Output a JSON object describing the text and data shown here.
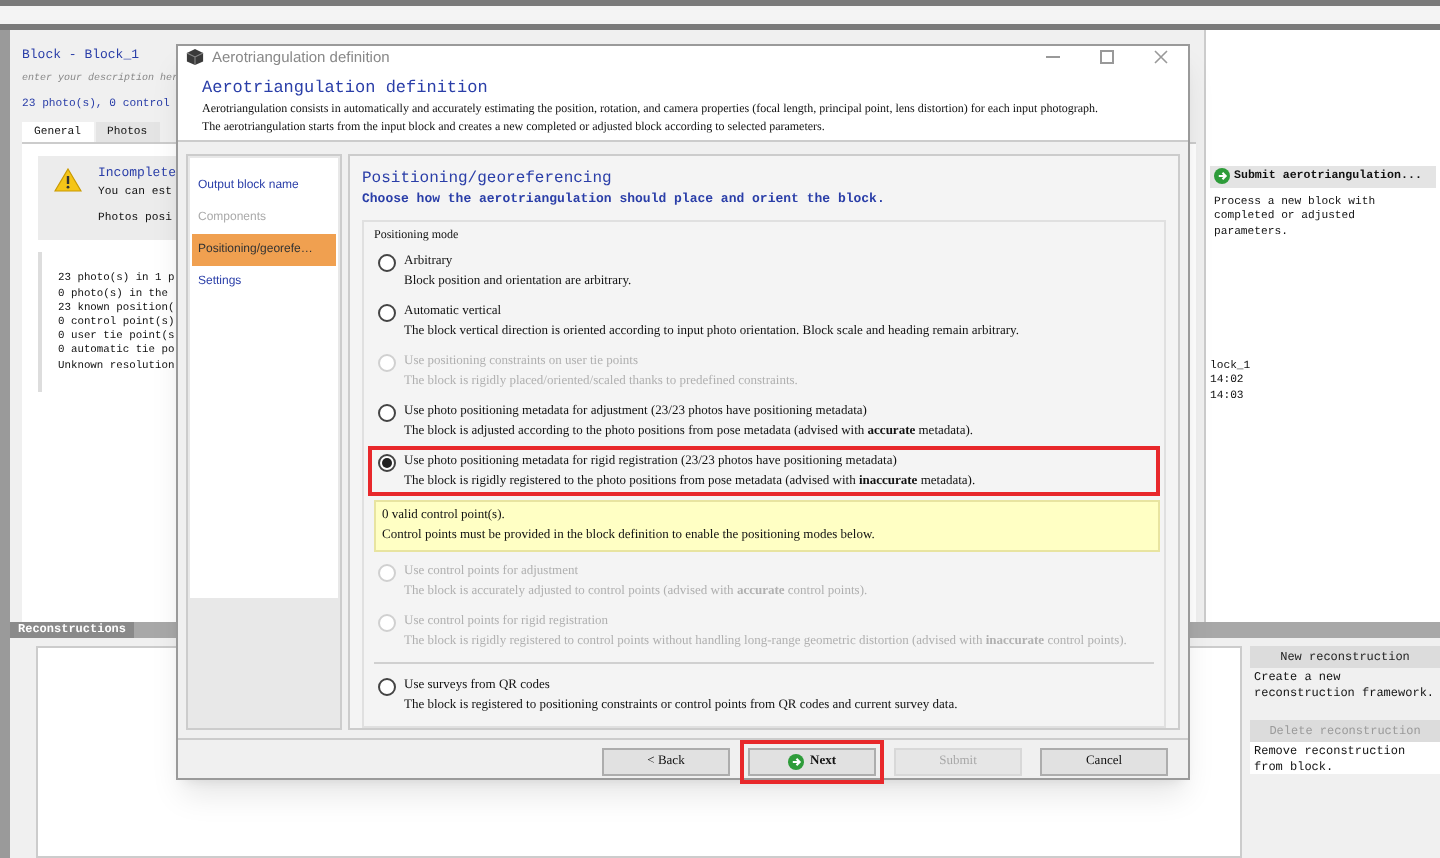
{
  "block": {
    "title": "Block - Block_1",
    "description_placeholder": "enter your description her",
    "summary": "23 photo(s), 0 control"
  },
  "tabs": [
    {
      "label": "General",
      "selected": true
    },
    {
      "label": "Photos",
      "selected": false
    }
  ],
  "warning": {
    "title": "Incomplete",
    "lines": [
      "You can est",
      "Photos posi"
    ]
  },
  "stats": [
    "23 photo(s) in 1 p",
    "0 photo(s) in the",
    "23 known position(",
    "0 control point(s)",
    "0 user tie point(s",
    "0 automatic tie po",
    "Unknown resolution"
  ],
  "side_texts": [
    "lock_1",
    "14:02",
    "14:03"
  ],
  "submit": {
    "label": "Submit aerotriangulation...",
    "description": "Process a new block with completed or adjusted parameters."
  },
  "reconstructions": {
    "title": "Reconstructions",
    "actions": [
      {
        "label": "New reconstruction",
        "disabled": false,
        "description": "Create a new reconstruction framework."
      },
      {
        "label": "Delete reconstruction",
        "disabled": true,
        "description": "Remove reconstruction from block."
      }
    ]
  },
  "dialog": {
    "window_title": "Aerotriangulation definition",
    "title": "Aerotriangulation definition",
    "intro": [
      "Aerotriangulation consists in automatically and accurately estimating the position, rotation, and camera properties (focal length, principal point, lens distortion) for each input photograph.",
      "The aerotriangulation starts from the input block and creates a new completed or adjusted block according to selected parameters."
    ],
    "steps": [
      {
        "label": "Output block name",
        "selected": false,
        "disabled": false
      },
      {
        "label": "Components",
        "selected": false,
        "disabled": true
      },
      {
        "label": "Positioning/georefe…",
        "selected": true,
        "disabled": false
      },
      {
        "label": "Settings",
        "selected": false,
        "disabled": false
      }
    ],
    "section_title": "Positioning/georeferencing",
    "section_subtitle": "Choose how the aerotriangulation should place and orient the block.",
    "group_label": "Positioning mode",
    "options": [
      {
        "kind": "radio",
        "label": "Arbitrary",
        "description": "Block position and orientation are arbitrary.",
        "selected": false,
        "disabled": false,
        "highlighted": false
      },
      {
        "kind": "radio",
        "label": "Automatic vertical",
        "description": "The block vertical direction is oriented according to input photo orientation. Block scale and heading remain arbitrary.",
        "selected": false,
        "disabled": false,
        "highlighted": false
      },
      {
        "kind": "radio",
        "label": "Use positioning constraints on user tie points",
        "description": "The block is rigidly placed/oriented/scaled thanks to predefined constraints.",
        "selected": false,
        "disabled": true,
        "highlighted": false
      },
      {
        "kind": "radio",
        "label": "Use photo positioning metadata for adjustment (23/23 photos have positioning metadata)",
        "description": "The block is adjusted according to the photo positions from pose metadata (advised with **accurate** metadata).",
        "selected": false,
        "disabled": false,
        "highlighted": false
      },
      {
        "kind": "radio",
        "label": "Use photo positioning metadata for rigid registration (23/23 photos have positioning metadata)",
        "description": "The block is rigidly registered to the photo positions from pose metadata (advised with **inaccurate** metadata).",
        "selected": true,
        "disabled": false,
        "highlighted": true
      },
      {
        "kind": "notice",
        "lines": [
          "0 valid control point(s).",
          "Control points must be provided in the block definition to enable the positioning modes below."
        ]
      },
      {
        "kind": "radio",
        "label": "Use control points for adjustment",
        "description": "The block is accurately adjusted to control points (advised with **accurate** control points).",
        "selected": false,
        "disabled": true,
        "highlighted": false
      },
      {
        "kind": "radio",
        "label": "Use control points for rigid registration",
        "description": "The block is rigidly registered to control points without handling long-range geometric distortion (advised with **inaccurate** control points).",
        "selected": false,
        "disabled": true,
        "highlighted": false
      },
      {
        "kind": "divider"
      },
      {
        "kind": "radio",
        "label": "Use surveys from QR codes",
        "description": "The block is registered to positioning constraints or control points from QR codes and current survey data.",
        "selected": false,
        "disabled": false,
        "highlighted": false
      }
    ],
    "buttons": [
      {
        "label": "< Back",
        "kind": "plain",
        "disabled": false,
        "highlighted": false
      },
      {
        "label": "Next",
        "kind": "primary",
        "disabled": false,
        "highlighted": true
      },
      {
        "label": "Submit",
        "kind": "plain",
        "disabled": true,
        "highlighted": false
      },
      {
        "label": "Cancel",
        "kind": "plain",
        "disabled": false,
        "highlighted": false
      }
    ]
  }
}
